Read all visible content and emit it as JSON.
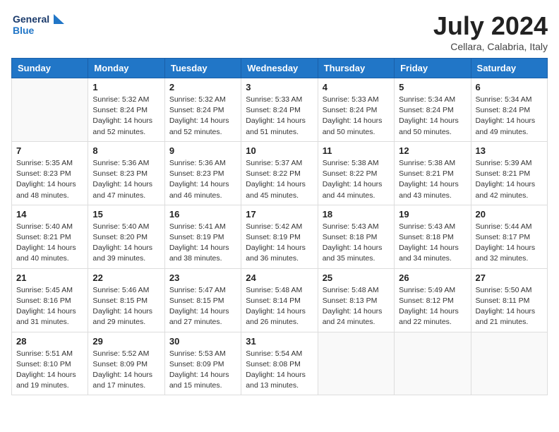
{
  "header": {
    "logo_line1": "General",
    "logo_line2": "Blue",
    "month_title": "July 2024",
    "location": "Cellara, Calabria, Italy"
  },
  "weekdays": [
    "Sunday",
    "Monday",
    "Tuesday",
    "Wednesday",
    "Thursday",
    "Friday",
    "Saturday"
  ],
  "weeks": [
    [
      {
        "day": "",
        "info": ""
      },
      {
        "day": "1",
        "info": "Sunrise: 5:32 AM\nSunset: 8:24 PM\nDaylight: 14 hours\nand 52 minutes."
      },
      {
        "day": "2",
        "info": "Sunrise: 5:32 AM\nSunset: 8:24 PM\nDaylight: 14 hours\nand 52 minutes."
      },
      {
        "day": "3",
        "info": "Sunrise: 5:33 AM\nSunset: 8:24 PM\nDaylight: 14 hours\nand 51 minutes."
      },
      {
        "day": "4",
        "info": "Sunrise: 5:33 AM\nSunset: 8:24 PM\nDaylight: 14 hours\nand 50 minutes."
      },
      {
        "day": "5",
        "info": "Sunrise: 5:34 AM\nSunset: 8:24 PM\nDaylight: 14 hours\nand 50 minutes."
      },
      {
        "day": "6",
        "info": "Sunrise: 5:34 AM\nSunset: 8:24 PM\nDaylight: 14 hours\nand 49 minutes."
      }
    ],
    [
      {
        "day": "7",
        "info": "Sunrise: 5:35 AM\nSunset: 8:23 PM\nDaylight: 14 hours\nand 48 minutes."
      },
      {
        "day": "8",
        "info": "Sunrise: 5:36 AM\nSunset: 8:23 PM\nDaylight: 14 hours\nand 47 minutes."
      },
      {
        "day": "9",
        "info": "Sunrise: 5:36 AM\nSunset: 8:23 PM\nDaylight: 14 hours\nand 46 minutes."
      },
      {
        "day": "10",
        "info": "Sunrise: 5:37 AM\nSunset: 8:22 PM\nDaylight: 14 hours\nand 45 minutes."
      },
      {
        "day": "11",
        "info": "Sunrise: 5:38 AM\nSunset: 8:22 PM\nDaylight: 14 hours\nand 44 minutes."
      },
      {
        "day": "12",
        "info": "Sunrise: 5:38 AM\nSunset: 8:21 PM\nDaylight: 14 hours\nand 43 minutes."
      },
      {
        "day": "13",
        "info": "Sunrise: 5:39 AM\nSunset: 8:21 PM\nDaylight: 14 hours\nand 42 minutes."
      }
    ],
    [
      {
        "day": "14",
        "info": "Sunrise: 5:40 AM\nSunset: 8:21 PM\nDaylight: 14 hours\nand 40 minutes."
      },
      {
        "day": "15",
        "info": "Sunrise: 5:40 AM\nSunset: 8:20 PM\nDaylight: 14 hours\nand 39 minutes."
      },
      {
        "day": "16",
        "info": "Sunrise: 5:41 AM\nSunset: 8:19 PM\nDaylight: 14 hours\nand 38 minutes."
      },
      {
        "day": "17",
        "info": "Sunrise: 5:42 AM\nSunset: 8:19 PM\nDaylight: 14 hours\nand 36 minutes."
      },
      {
        "day": "18",
        "info": "Sunrise: 5:43 AM\nSunset: 8:18 PM\nDaylight: 14 hours\nand 35 minutes."
      },
      {
        "day": "19",
        "info": "Sunrise: 5:43 AM\nSunset: 8:18 PM\nDaylight: 14 hours\nand 34 minutes."
      },
      {
        "day": "20",
        "info": "Sunrise: 5:44 AM\nSunset: 8:17 PM\nDaylight: 14 hours\nand 32 minutes."
      }
    ],
    [
      {
        "day": "21",
        "info": "Sunrise: 5:45 AM\nSunset: 8:16 PM\nDaylight: 14 hours\nand 31 minutes."
      },
      {
        "day": "22",
        "info": "Sunrise: 5:46 AM\nSunset: 8:15 PM\nDaylight: 14 hours\nand 29 minutes."
      },
      {
        "day": "23",
        "info": "Sunrise: 5:47 AM\nSunset: 8:15 PM\nDaylight: 14 hours\nand 27 minutes."
      },
      {
        "day": "24",
        "info": "Sunrise: 5:48 AM\nSunset: 8:14 PM\nDaylight: 14 hours\nand 26 minutes."
      },
      {
        "day": "25",
        "info": "Sunrise: 5:48 AM\nSunset: 8:13 PM\nDaylight: 14 hours\nand 24 minutes."
      },
      {
        "day": "26",
        "info": "Sunrise: 5:49 AM\nSunset: 8:12 PM\nDaylight: 14 hours\nand 22 minutes."
      },
      {
        "day": "27",
        "info": "Sunrise: 5:50 AM\nSunset: 8:11 PM\nDaylight: 14 hours\nand 21 minutes."
      }
    ],
    [
      {
        "day": "28",
        "info": "Sunrise: 5:51 AM\nSunset: 8:10 PM\nDaylight: 14 hours\nand 19 minutes."
      },
      {
        "day": "29",
        "info": "Sunrise: 5:52 AM\nSunset: 8:09 PM\nDaylight: 14 hours\nand 17 minutes."
      },
      {
        "day": "30",
        "info": "Sunrise: 5:53 AM\nSunset: 8:09 PM\nDaylight: 14 hours\nand 15 minutes."
      },
      {
        "day": "31",
        "info": "Sunrise: 5:54 AM\nSunset: 8:08 PM\nDaylight: 14 hours\nand 13 minutes."
      },
      {
        "day": "",
        "info": ""
      },
      {
        "day": "",
        "info": ""
      },
      {
        "day": "",
        "info": ""
      }
    ]
  ]
}
